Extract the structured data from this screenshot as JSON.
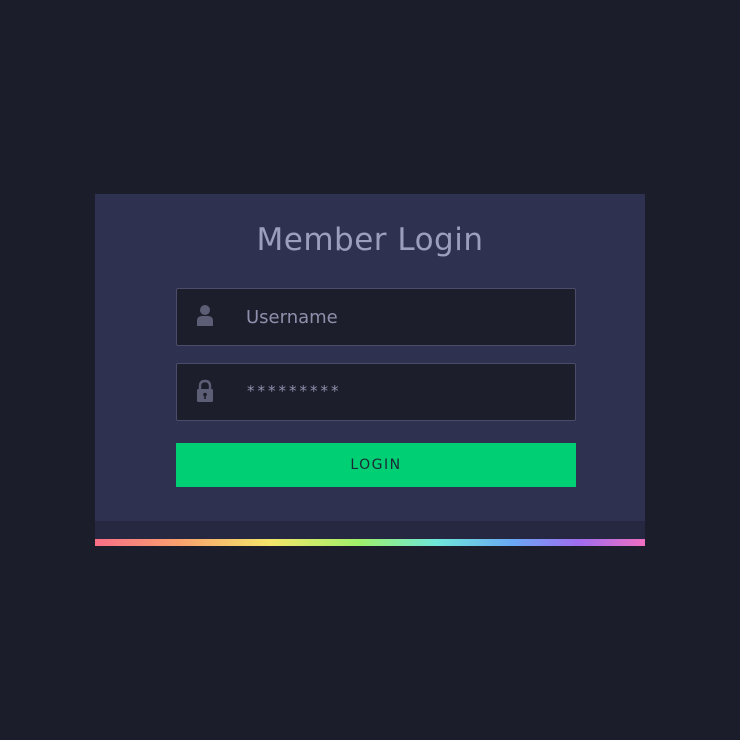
{
  "form": {
    "title": "Member Login",
    "username": {
      "placeholder": "Username",
      "value": "",
      "icon": "user-icon"
    },
    "password": {
      "masked_value": "*********",
      "icon": "lock-icon"
    },
    "login_label": "LOGIN"
  },
  "colors": {
    "background": "#1b1d2a",
    "card": "#2f3150",
    "field": "#1d1e2c",
    "accent": "#00cf73",
    "text_muted": "#9c9ebd"
  }
}
